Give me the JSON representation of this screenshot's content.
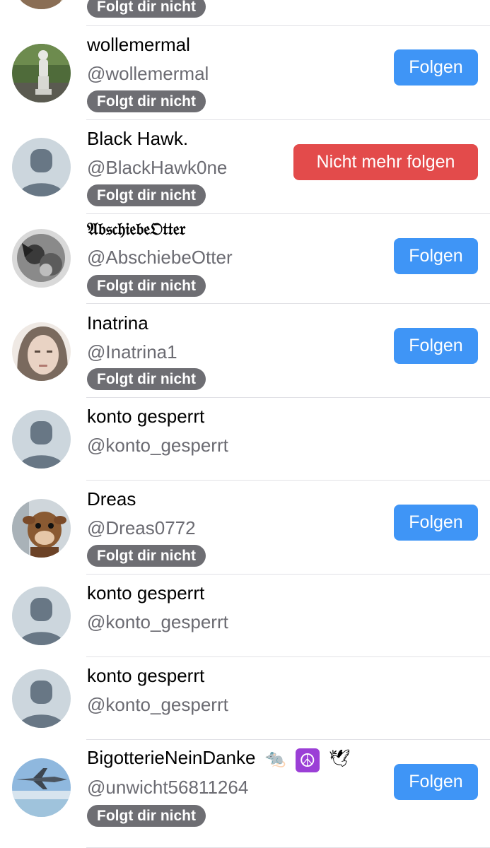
{
  "colors": {
    "follow": "#3f95f6",
    "unfollow": "#e34b4b",
    "badge": "#6e6e73",
    "handle": "#6b6b72",
    "divider": "#e1e1e6"
  },
  "rows": [
    {
      "badge": "Folgt dir nicht"
    },
    {
      "name": "wollemermal",
      "handle": "@wollemermal",
      "badge": "Folgt dir nicht",
      "button": "Folgen",
      "avatar_icon": "statue-photo-avatar"
    },
    {
      "name": "Black Hawk.",
      "handle": "@BlackHawk0ne",
      "badge": "Folgt dir nicht",
      "button": "Nicht mehr folgen",
      "avatar_icon": "default-avatar"
    },
    {
      "name": "𝔄𝔟𝔰𝔠𝔥𝔦𝔢𝔟𝔢𝔒𝔱𝔱𝔢𝔯",
      "handle": "@AbschiebeOtter",
      "badge": "Folgt dir nicht",
      "button": "Folgen",
      "avatar_icon": "otter-photo-avatar"
    },
    {
      "name": "Inatrina",
      "handle": "@Inatrina1",
      "badge": "Folgt dir nicht",
      "button": "Folgen",
      "avatar_icon": "portrait-photo-avatar"
    },
    {
      "name": "konto gesperrt",
      "handle": "@konto_gesperrt",
      "avatar_icon": "default-avatar"
    },
    {
      "name": "Dreas",
      "handle": "@Dreas0772",
      "badge": "Folgt dir nicht",
      "button": "Folgen",
      "avatar_icon": "plush-cow-photo-avatar"
    },
    {
      "name": "konto gesperrt",
      "handle": "@konto_gesperrt",
      "avatar_icon": "default-avatar"
    },
    {
      "name": "konto gesperrt",
      "handle": "@konto_gesperrt",
      "avatar_icon": "default-avatar"
    },
    {
      "name": "BigotterieNeinDanke",
      "name_emoji": [
        "🐀",
        "☮",
        "🕊"
      ],
      "handle": "@unwicht56811264",
      "badge": "Folgt dir nicht",
      "button": "Folgen",
      "avatar_icon": "jet-photo-avatar"
    }
  ]
}
